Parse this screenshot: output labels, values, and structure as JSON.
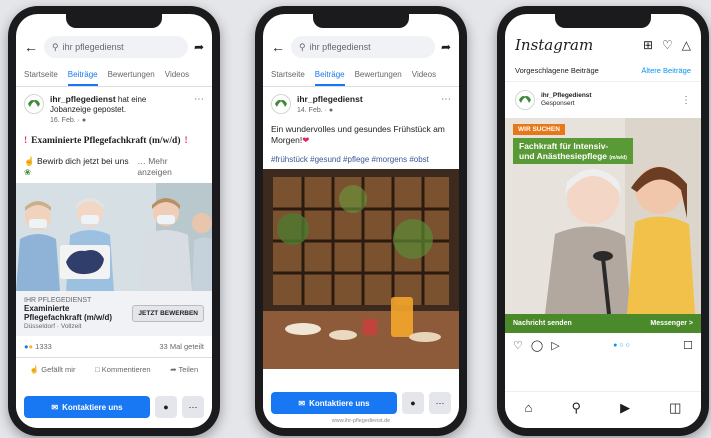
{
  "colors": {
    "facebook_blue": "#1877f2",
    "instagram_link": "#0095f6",
    "badge_orange": "#e77817",
    "ad_green": "#5a9a36",
    "exclamation_red": "#e0245e"
  },
  "phone1": {
    "search_placeholder": "ihr pflegedienst",
    "tabs": [
      "Startseite",
      "Beiträge",
      "Bewertungen",
      "Videos"
    ],
    "active_tab": "Beiträge",
    "page_name": "ihr_pflegedienst",
    "post_action": "hat eine Jobanzeige gepostet.",
    "date": "16. Feb. · ",
    "headline": "Examinierte Pflegefachkraft (m/w/d)",
    "text": "Bewirb dich jetzt bei uns",
    "more": "… Mehr anzeigen",
    "ad_company": "IHR PFLEGEDIENST",
    "ad_title": "Examinierte Pflegefachkraft (m/w/d)",
    "ad_location": "Düsseldorf · Vollzeit",
    "ad_button": "JETZT BEWERBEN",
    "reaction_count": "1333",
    "shares": "33 Mal geteilt",
    "like": "Gefällt mir",
    "comment": "Kommentieren",
    "share": "Teilen",
    "contact": "Kontaktiere uns",
    "icon_labels": [
      "back-arrow-icon",
      "search-icon",
      "share-icon",
      "messenger-icon",
      "more-icon"
    ]
  },
  "phone2": {
    "search_placeholder": "ihr pflegedienst",
    "tabs": [
      "Startseite",
      "Beiträge",
      "Bewertungen",
      "Videos"
    ],
    "active_tab": "Beiträge",
    "page_name": "ihr_pflegedienst",
    "date": "14. Feb. · ",
    "text": "Ein wundervolles und gesundes Frühstück am Morgen!",
    "hashtags": "#frühstück #gesund #pflege #morgens #obst",
    "contact": "Kontaktiere uns",
    "url": "www.ihr-pflegedienst.de"
  },
  "phone3": {
    "logo": "Instagram",
    "suggested": "Vorgeschlagene Beiträge",
    "older": "Ältere Beiträge",
    "account": "ihr_Pflegedienst",
    "sponsored": "Gesponsert",
    "badge": "WIR SUCHEN",
    "ad_title_line1": "Fachkraft für Intensiv-",
    "ad_title_line2": "und Anästhesiepflege",
    "ad_title_suffix": "(m/w/d)",
    "message_left": "Nachricht senden",
    "message_right": "Messenger >"
  }
}
